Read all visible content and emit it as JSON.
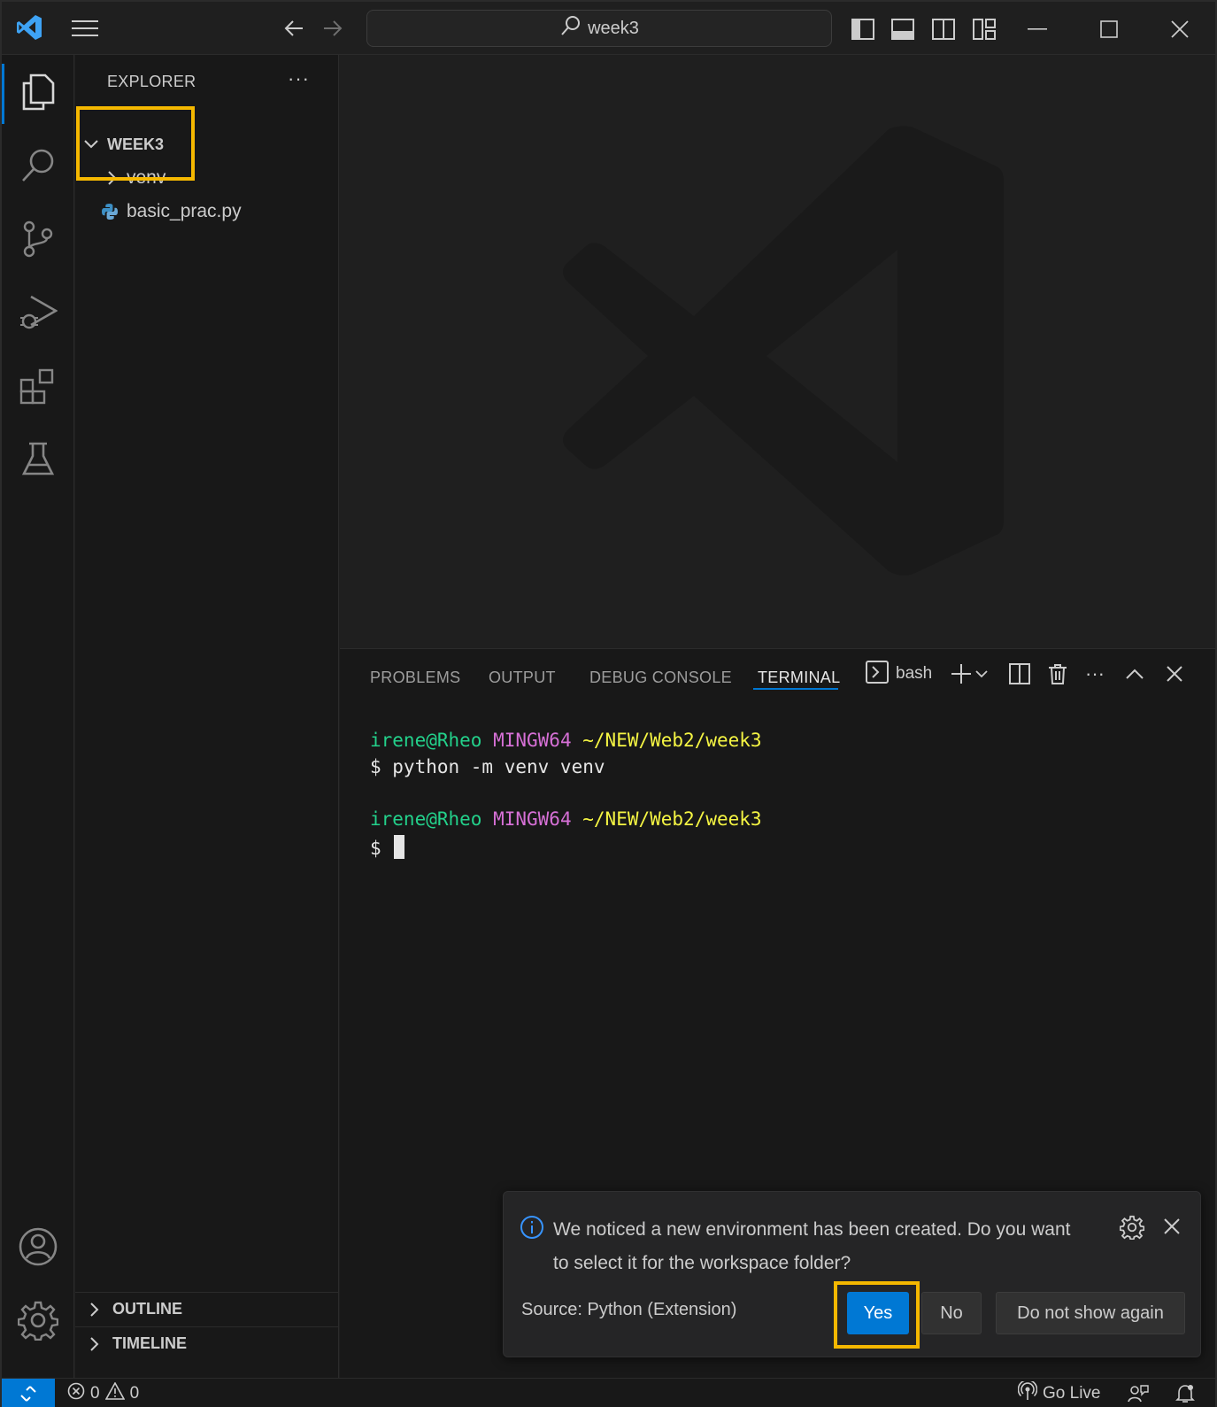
{
  "titlebar": {
    "search_text": "week3",
    "icons": [
      "vscode-logo-icon",
      "menu-icon",
      "back-arrow-icon",
      "forward-arrow-icon",
      "toggle-primary-sidebar-icon",
      "toggle-panel-icon",
      "toggle-secondary-sidebar-icon",
      "customize-layout-icon",
      "minimize-icon",
      "maximize-icon",
      "close-icon"
    ]
  },
  "activity_bar": {
    "items": [
      "explorer-icon",
      "search-icon",
      "source-control-icon",
      "run-debug-icon",
      "extensions-icon",
      "testing-icon"
    ],
    "bottom": [
      "accounts-icon",
      "manage-gear-icon"
    ]
  },
  "sidebar": {
    "title": "EXPLORER",
    "more": "···",
    "folder": "WEEK3",
    "items": [
      {
        "label": "venv",
        "type": "folder"
      },
      {
        "label": "basic_prac.py",
        "type": "python-file"
      }
    ],
    "sections": [
      "OUTLINE",
      "TIMELINE"
    ]
  },
  "panel": {
    "tabs": [
      "PROBLEMS",
      "OUTPUT",
      "DEBUG CONSOLE",
      "TERMINAL"
    ],
    "active_tab": "TERMINAL",
    "shell": "bash",
    "terminal": {
      "user": "irene@Rheo",
      "system": "MINGW64",
      "path": "~/NEW/Web2/week3",
      "command": "$ python -m venv venv",
      "prompt": "$"
    }
  },
  "notification": {
    "message": "We noticed a new environment has been created. Do you want to select it for the workspace folder?",
    "source": "Source: Python (Extension)",
    "buttons": {
      "yes": "Yes",
      "no": "No",
      "dont_show": "Do not show again"
    }
  },
  "statusbar": {
    "errors": "0",
    "warnings": "0",
    "go_live": "Go Live"
  },
  "colors": {
    "accent": "#0078d4",
    "highlight": "#f5b800",
    "terminal_green": "#23d18b",
    "terminal_magenta": "#d670d6",
    "terminal_yellow": "#f5f543"
  }
}
